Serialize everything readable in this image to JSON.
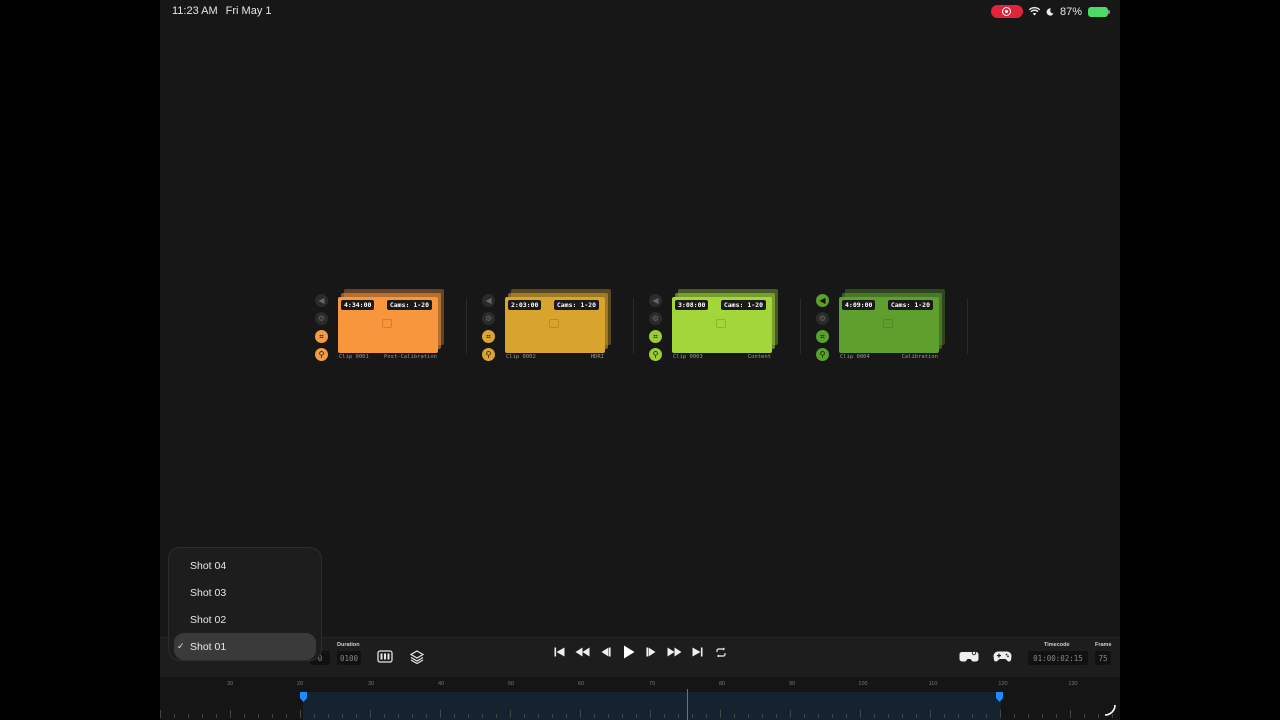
{
  "status": {
    "time": "11:23 AM",
    "date": "Fri May 1",
    "battery": "87%"
  },
  "clips": [
    {
      "timecode": "4:34:00",
      "cams": "Cams: 1-20",
      "name": "Clip 0001",
      "type": "Post-Calibration",
      "color": "#f7963c",
      "icon_color": "#f29c43"
    },
    {
      "timecode": "2:03:00",
      "cams": "Cams: 1-20",
      "name": "Clip 0002",
      "type": "HDRI",
      "color": "#d8a42d",
      "icon_color": "#d9a633"
    },
    {
      "timecode": "3:08:00",
      "cams": "Cams: 1-20",
      "name": "Clip 0003",
      "type": "Content",
      "color": "#a3d63a",
      "icon_color": "#9ccc35"
    },
    {
      "timecode": "4:09:00",
      "cams": "Cams: 1-20",
      "name": "Clip 0004",
      "type": "Calibration",
      "color": "#5e9f2e",
      "icon_color": "#5aa02c"
    }
  ],
  "toolbar": {
    "duration_label": "Duration",
    "duration_value": "0100",
    "start_value": "0",
    "timecode_label": "Timecode",
    "timecode_value": "01:00:02:15",
    "frame_label": "Frame",
    "frame_value": "75"
  },
  "timeline": {
    "ruler": [
      "30",
      "30",
      "40",
      "50",
      "60",
      "70",
      "80",
      "90",
      "100",
      "110",
      "120",
      "130"
    ],
    "ruler_first": "20"
  },
  "shot_menu": {
    "items": [
      "Shot 04",
      "Shot 03",
      "Shot 02",
      "Shot 01"
    ],
    "selected": "Shot 01"
  },
  "colors": {
    "accent": "#1e8cff",
    "playhead": "#ff2d55",
    "record": "#e0243a"
  }
}
